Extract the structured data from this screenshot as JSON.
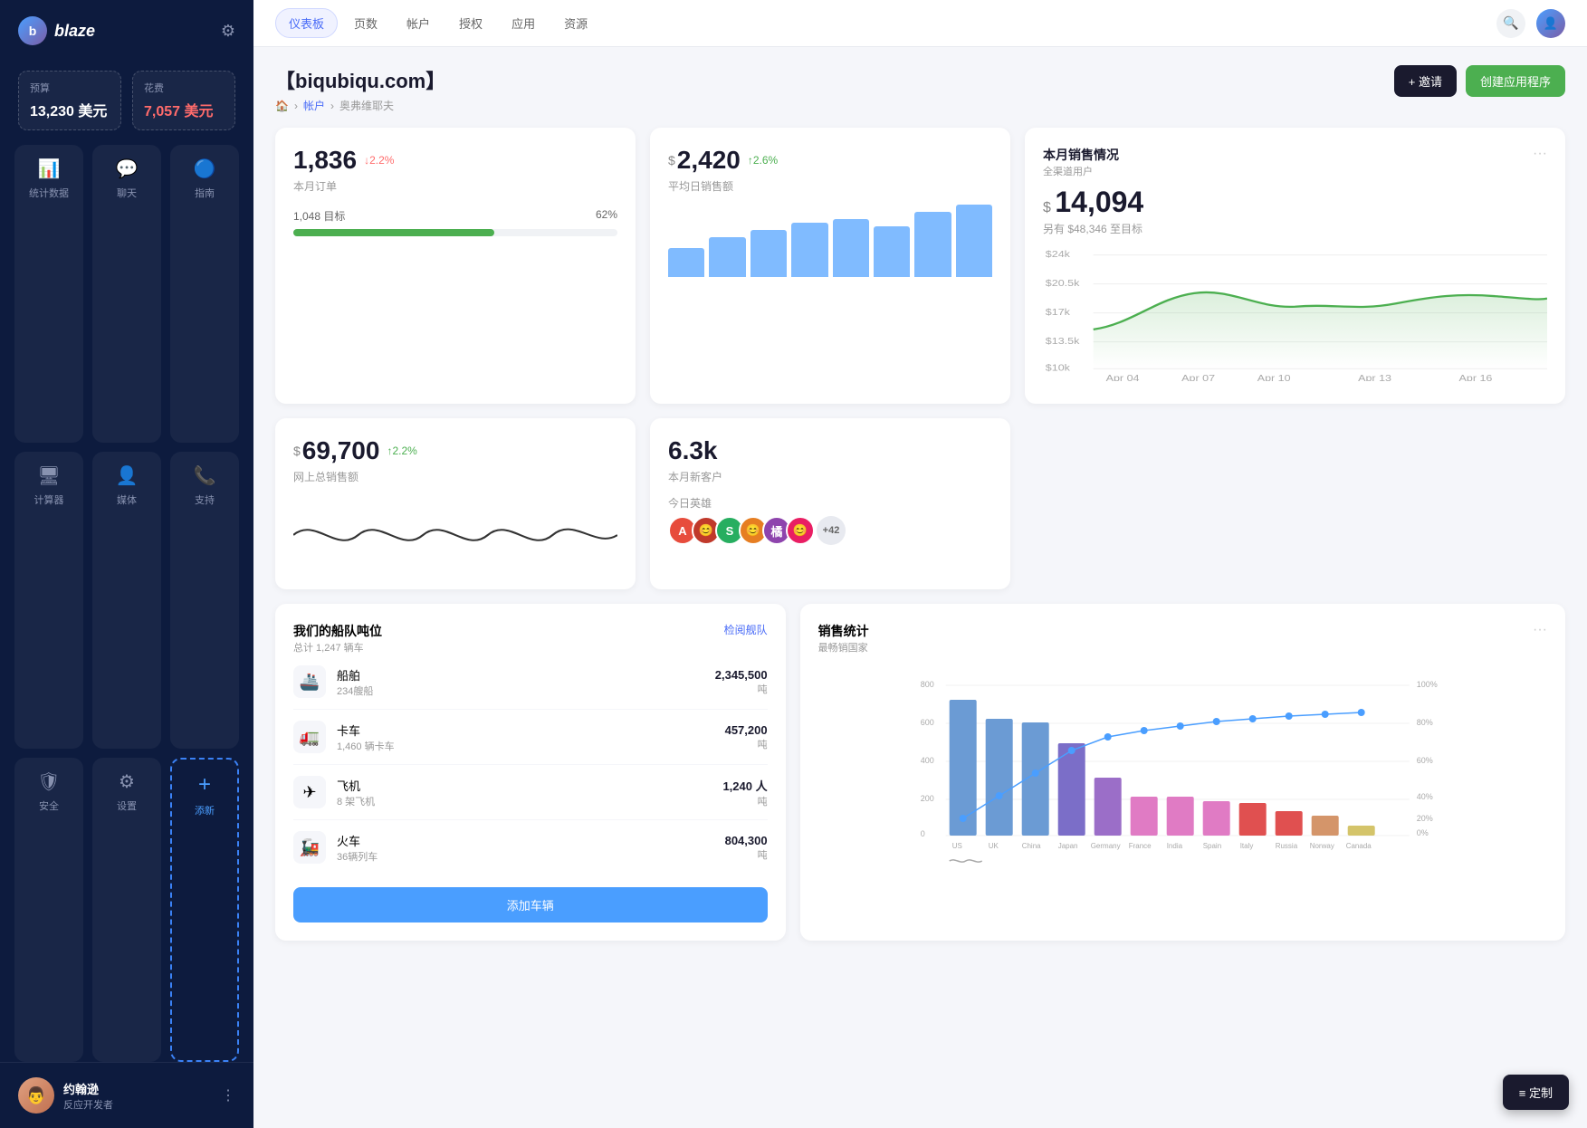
{
  "app": {
    "name": "blaze"
  },
  "sidebar": {
    "budget": {
      "label": "预算",
      "value": "13,230 美元"
    },
    "expense": {
      "label": "花费",
      "value": "7,057 美元"
    },
    "nav": [
      {
        "id": "stats",
        "label": "统计数据",
        "icon": "📊",
        "active": false
      },
      {
        "id": "chat",
        "label": "聊天",
        "icon": "💬",
        "active": false
      },
      {
        "id": "guide",
        "label": "指南",
        "icon": "🔵",
        "active": false
      },
      {
        "id": "calc",
        "label": "计算器",
        "icon": "🖥",
        "active": false
      },
      {
        "id": "media",
        "label": "媒体",
        "icon": "👤",
        "active": false
      },
      {
        "id": "support",
        "label": "支持",
        "icon": "📞",
        "active": false
      },
      {
        "id": "security",
        "label": "安全",
        "icon": "🛡",
        "active": false
      },
      {
        "id": "settings",
        "label": "设置",
        "icon": "⚙",
        "active": false
      },
      {
        "id": "add",
        "label": "添新",
        "icon": "+",
        "active": true
      }
    ],
    "user": {
      "name": "约翰逊",
      "role": "反应开发者"
    }
  },
  "topnav": {
    "items": [
      {
        "label": "仪表板",
        "active": true
      },
      {
        "label": "页数",
        "active": false
      },
      {
        "label": "帐户",
        "active": false
      },
      {
        "label": "授权",
        "active": false
      },
      {
        "label": "应用",
        "active": false
      },
      {
        "label": "资源",
        "active": false
      }
    ]
  },
  "page": {
    "title": "【biqubiqu.com】",
    "breadcrumb": [
      "🏠",
      "帐户",
      "奥弗维耶夫"
    ],
    "actions": {
      "invite": "+ 邀请",
      "create": "创建应用程序"
    }
  },
  "stats": {
    "orders": {
      "value": "1,836",
      "change": "↓2.2%",
      "change_dir": "down",
      "label": "本月订单",
      "progress_label": "1,048 目标",
      "progress_pct": "62%",
      "progress_val": 62
    },
    "avg_sales": {
      "value": "2,420",
      "change": "↑2.6%",
      "change_dir": "up",
      "label": "平均日销售额"
    },
    "monthly_sales": {
      "title": "本月销售情况",
      "subtitle": "全渠道用户",
      "value": "14,094",
      "sub": "另有 $48,346 至目标",
      "y_labels": [
        "$24k",
        "$20.5k",
        "$17k",
        "$13.5k",
        "$10k"
      ],
      "x_labels": [
        "Apr 04",
        "Apr 07",
        "Apr 10",
        "Apr 13",
        "Apr 16"
      ]
    },
    "online_sales": {
      "value": "69,700",
      "change": "↑2.2%",
      "change_dir": "up",
      "label": "网上总销售额"
    },
    "new_customers": {
      "value": "6.3k",
      "label": "本月新客户",
      "heroes_label": "今日英雄",
      "heroes_count": "+42"
    }
  },
  "fleet": {
    "title": "我们的船队吨位",
    "subtitle": "总计 1,247 辆车",
    "link": "检阅舰队",
    "items": [
      {
        "name": "船舶",
        "sub": "234艘船",
        "value": "2,345,500",
        "unit": "吨",
        "icon": "🚢"
      },
      {
        "name": "卡车",
        "sub": "1,460 辆卡车",
        "value": "457,200",
        "unit": "吨",
        "icon": "🚛"
      },
      {
        "name": "飞机",
        "sub": "8 架飞机",
        "value": "1,240 人",
        "unit": "吨",
        "icon": "✈"
      },
      {
        "name": "火车",
        "sub": "36辆列车",
        "value": "804,300",
        "unit": "吨",
        "icon": "🚂"
      }
    ],
    "add_btn": "添加车辆"
  },
  "sales_stats": {
    "title": "销售统计",
    "subtitle": "最畅销国家",
    "countries": [
      "US",
      "UK",
      "China",
      "Japan",
      "Germany",
      "France",
      "India",
      "Spain",
      "Italy",
      "Russia",
      "Norway",
      "Canada"
    ],
    "values": [
      720,
      620,
      600,
      490,
      310,
      205,
      205,
      185,
      175,
      130,
      105,
      55
    ],
    "y_labels": [
      "800",
      "600",
      "400",
      "200",
      "0"
    ],
    "pct_labels": [
      "100%",
      "80%",
      "60%",
      "40%",
      "20%",
      "0%"
    ]
  },
  "customize": {
    "label": "≡ 定制"
  }
}
